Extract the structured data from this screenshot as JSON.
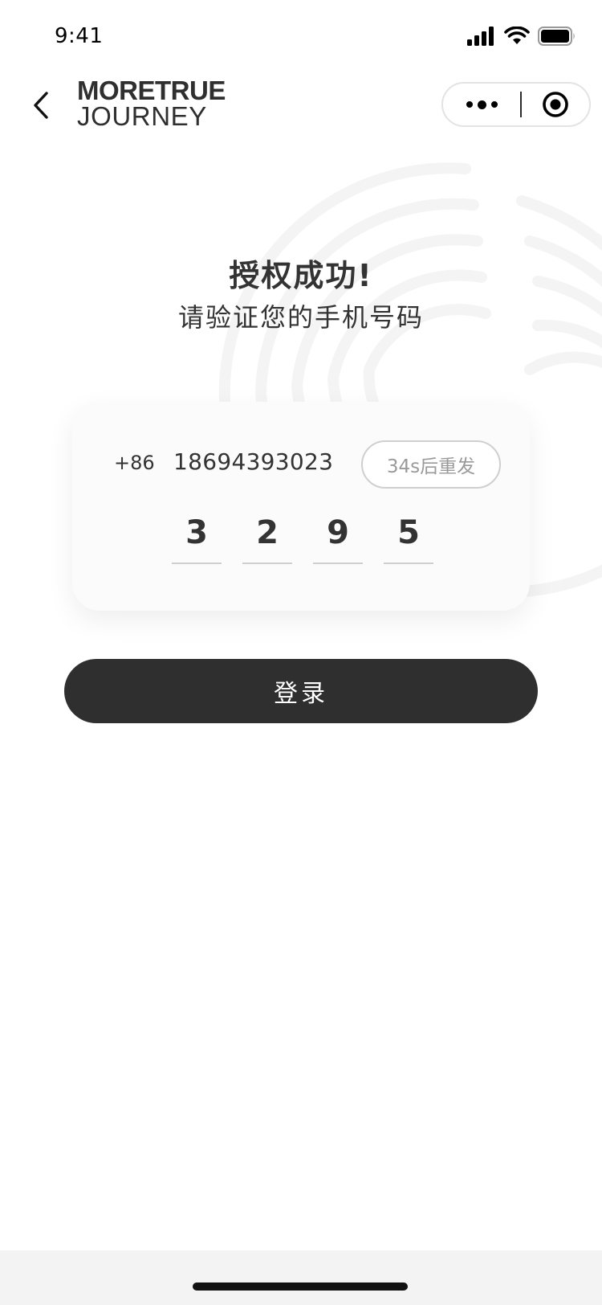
{
  "status_bar": {
    "time": "9:41"
  },
  "nav": {
    "logo_line1": "MORETRUE",
    "logo_line2": "JOURNEY"
  },
  "content": {
    "title": "授权成功!",
    "subtitle": "请验证您的手机号码"
  },
  "form": {
    "country_code": "+86",
    "phone_number": "18694393023",
    "resend_label": "34s后重发",
    "code_digits": [
      "3",
      "2",
      "9",
      "5"
    ]
  },
  "actions": {
    "login_label": "登录"
  },
  "icons": {
    "back": "chevron-left-icon",
    "more": "more-dots-icon",
    "close": "target-circle-icon",
    "signal": "signal-icon",
    "wifi": "wifi-icon",
    "battery": "battery-icon"
  },
  "colors": {
    "primary_button": "#2f2f2f",
    "text": "#333333",
    "muted": "#9a9a9a",
    "card_bg": "#fbfbfb"
  }
}
